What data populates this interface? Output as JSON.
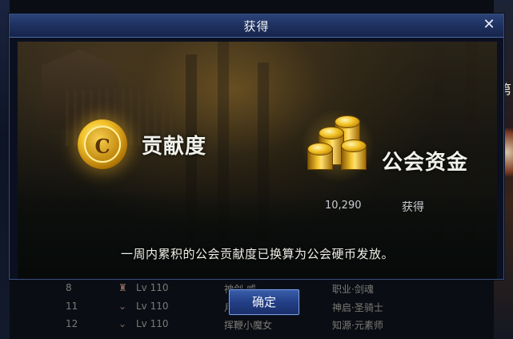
{
  "dialog": {
    "title": "获得",
    "close_icon": "close-icon",
    "contribution": {
      "label": "贡献度",
      "icon": "contribution-coin-icon",
      "icon_letter": "C"
    },
    "guild_fund": {
      "label": "公会资金",
      "icon": "gold-coins-icon",
      "amount": "10,290",
      "status": "获得"
    },
    "notice": "一周内累积的公会贡献度已换算为公会硬币发放。",
    "confirm_label": "确定"
  },
  "background": {
    "side_glyph": "第",
    "list_rows": [
      {
        "num": "8",
        "level": "Lv 110",
        "name": "神剑·威",
        "class": "职业·剑魂"
      },
      {
        "num": "11",
        "level": "Lv 110",
        "name": "月",
        "class": "神启·圣骑士"
      },
      {
        "num": "12",
        "level": "Lv 110",
        "name": "挥鞭小魔女",
        "class": "知源·元素师"
      }
    ]
  },
  "colors": {
    "title_bar": "#1e3160",
    "gold": "#f0be20",
    "button": "#233f86"
  }
}
